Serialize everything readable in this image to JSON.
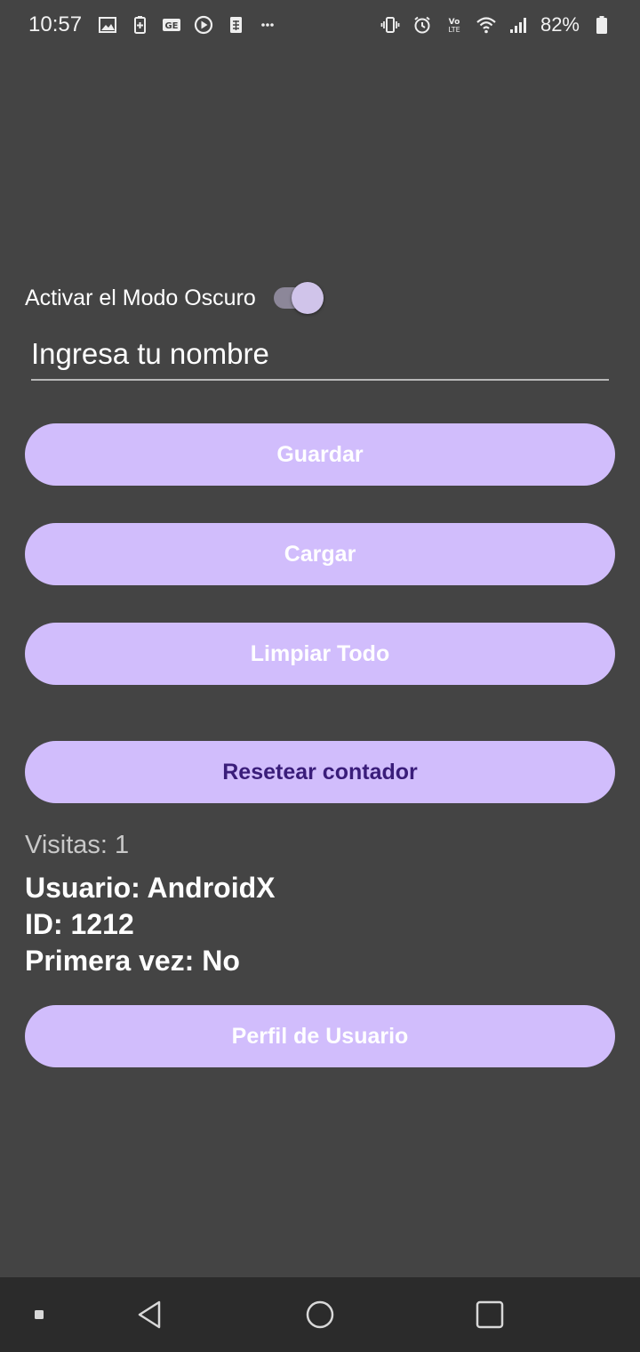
{
  "status_bar": {
    "time": "10:57",
    "battery_percent": "82%",
    "left_icons": [
      "image-icon",
      "battery-saver-icon",
      "ge-icon",
      "play-icon",
      "sim-icon",
      "more-icon"
    ],
    "right_icons": [
      "vibrate-icon",
      "alarm-icon",
      "volte-icon",
      "wifi-icon",
      "signal-icon",
      "battery-icon"
    ]
  },
  "settings": {
    "dark_mode_label": "Activar el Modo Oscuro",
    "dark_mode_enabled": true
  },
  "name_input": {
    "placeholder": "Ingresa tu nombre",
    "value": ""
  },
  "buttons": {
    "save": "Guardar",
    "load": "Cargar",
    "clear_all": "Limpiar Todo",
    "reset_counter": "Resetear contador",
    "user_profile": "Perfil de Usuario"
  },
  "info": {
    "visits": "Visitas: 1",
    "user": "Usuario: AndroidX",
    "id": "ID: 1212",
    "first_time": "Primera vez: No"
  },
  "colors": {
    "background": "#444444",
    "button": "#d1bdfc",
    "button_dark_text": "#3a1d7a"
  },
  "nav_bar": {
    "icons": [
      "menu-dot-icon",
      "back-icon",
      "home-icon",
      "recents-icon"
    ]
  }
}
